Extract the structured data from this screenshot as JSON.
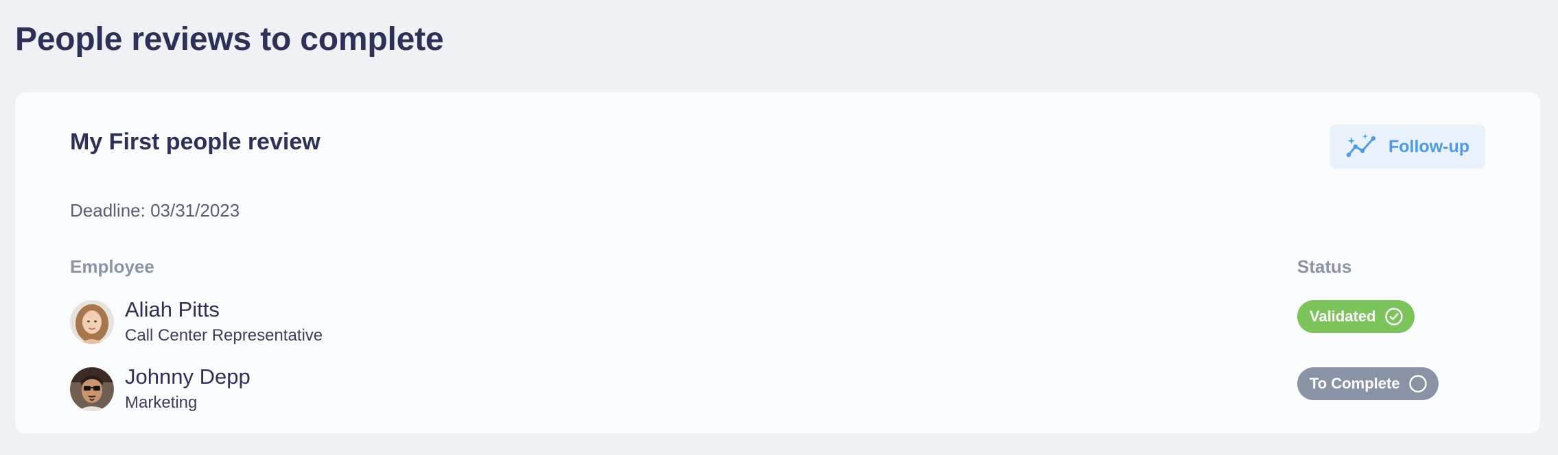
{
  "page": {
    "title": "People reviews to complete"
  },
  "review": {
    "title": "My First people review",
    "followup_label": "Follow-up",
    "deadline": "Deadline: 03/31/2023",
    "columns": {
      "employee": "Employee",
      "status": "Status"
    },
    "rows": [
      {
        "name": "Aliah Pitts",
        "role": "Call Center Representative",
        "status": "Validated",
        "status_icon": "check-circle-icon",
        "status_color": "#7dc35b"
      },
      {
        "name": "Johnny Depp",
        "role": "Marketing",
        "status": "To Complete",
        "status_icon": "empty-circle-icon",
        "status_color": "#8894a6"
      }
    ]
  },
  "colors": {
    "accent": "#4d9be8",
    "followup_bg": "#e8f1fc",
    "title": "#2d3157",
    "page_bg": "#f0f1f5",
    "card_bg": "#fafbfd"
  }
}
